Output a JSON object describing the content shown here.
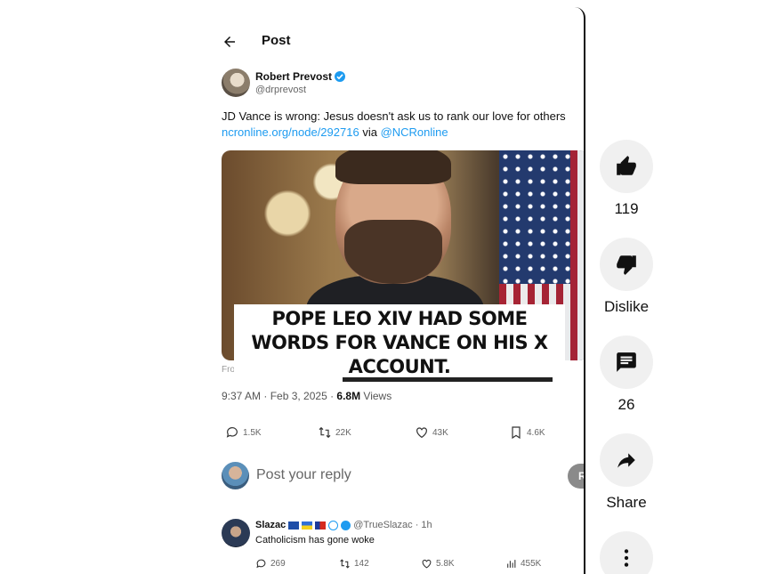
{
  "post": {
    "header_title": "Post",
    "author_name": "Robert Prevost",
    "author_handle": "@drprevost",
    "text": "JD Vance is wrong: Jesus doesn't ask us to rank our love for others",
    "link_url": "ncronline.org/node/292716",
    "link_via": "via",
    "link_mention": "@NCRonline",
    "media_caption_lines": [
      "POPE LEO XIV HAD SOME",
      "WORDS FOR VANCE ON HIS X",
      "ACCOUNT."
    ],
    "media_from": "From ncronline.org",
    "timestamp": "9:37 AM · Feb 3, 2025 · ",
    "views_count": "6.8M",
    "views_label": " Views",
    "stats": {
      "replies": "1.5K",
      "reposts": "22K",
      "likes": "43K",
      "bookmarks": "4.6K"
    },
    "reply_placeholder": "Post your reply",
    "reply_button": "R"
  },
  "comment": {
    "name": "Slazac",
    "handle": "@TrueSlazac · 1h",
    "text": "Catholicism has gone woke",
    "stats": {
      "replies": "269",
      "reposts": "142",
      "likes": "5.8K",
      "views": "455K"
    }
  },
  "rail": {
    "like_count": "119",
    "dislike_label": "Dislike",
    "comments_count": "26",
    "share_label": "Share"
  },
  "icons": {
    "back": "back-arrow-icon",
    "verified": "verified-badge-icon",
    "reply": "reply-bubble-icon",
    "repost": "repost-icon",
    "like": "heart-icon",
    "bookmark": "bookmark-icon",
    "views": "bar-chart-icon",
    "thumbs_up": "thumbs-up-icon",
    "thumbs_down": "thumbs-down-icon",
    "comments": "comment-icon",
    "share": "share-arrow-icon",
    "more": "more-vert-icon"
  },
  "colors": {
    "link": "#1d9bf0",
    "verified": "#1d9bf0",
    "rail_button": "#f0f0f0"
  }
}
